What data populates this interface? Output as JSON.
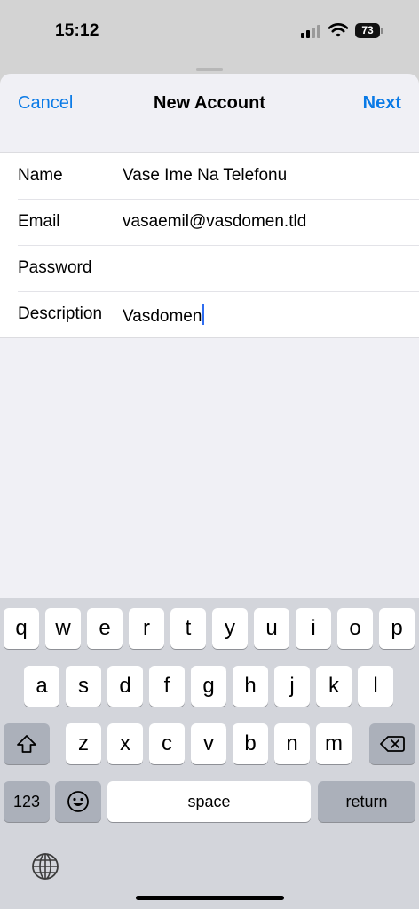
{
  "status_bar": {
    "time": "15:12",
    "battery_level": "73",
    "icons": [
      "cellular-signal-icon",
      "wifi-icon",
      "battery-icon"
    ]
  },
  "nav": {
    "cancel_label": "Cancel",
    "title": "New Account",
    "next_label": "Next",
    "accent_color": "#0a7ae6"
  },
  "form": {
    "rows": [
      {
        "label": "Name",
        "value": "Vase Ime Na Telefonu"
      },
      {
        "label": "Email",
        "value": "vasaemil@vasdomen.tld"
      },
      {
        "label": "Password",
        "value": ""
      },
      {
        "label": "Description",
        "value": "Vasdomen"
      }
    ]
  },
  "keyboard": {
    "row1": [
      "q",
      "w",
      "e",
      "r",
      "t",
      "y",
      "u",
      "i",
      "o",
      "p"
    ],
    "row2": [
      "a",
      "s",
      "d",
      "f",
      "g",
      "h",
      "j",
      "k",
      "l"
    ],
    "row3": [
      "z",
      "x",
      "c",
      "v",
      "b",
      "n",
      "m"
    ],
    "numbers_label": "123",
    "space_label": "space",
    "return_label": "return",
    "icons": [
      "shift-icon",
      "delete-icon",
      "emoji-icon",
      "globe-icon"
    ]
  }
}
